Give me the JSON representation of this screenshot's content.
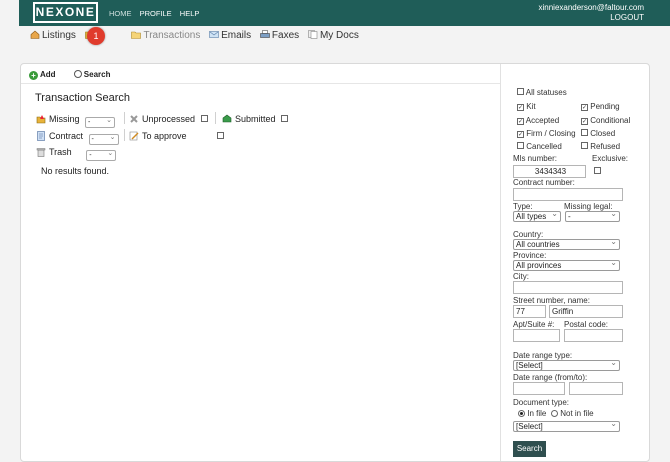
{
  "header": {
    "logo": "NEXONE",
    "nav": [
      "HOME",
      "PROFILE",
      "HELP"
    ],
    "user_email": "xinniexanderson@faltour.com",
    "logout": "LOGOUT",
    "bg_color": "#1f5d58"
  },
  "tabs": [
    {
      "label": "Listings",
      "icon": "house-icon"
    },
    {
      "label": "Transactions",
      "icon": "folder-icon"
    },
    {
      "label": "Emails",
      "icon": "envelope-icon"
    },
    {
      "label": "Faxes",
      "icon": "printer-icon"
    },
    {
      "label": "My Docs",
      "icon": "documents-icon"
    }
  ],
  "step_badge": "1",
  "toolbar": {
    "add": "Add",
    "search": "Search"
  },
  "main": {
    "title": "Transaction Search",
    "filters": {
      "missing": {
        "label": "Missing",
        "value": "-"
      },
      "contract": {
        "label": "Contract",
        "value": "-"
      },
      "trash": {
        "label": "Trash",
        "value": "-"
      },
      "unprocessed": {
        "label": "Unprocessed",
        "checked": false
      },
      "to_approve": {
        "label": "To approve",
        "checked": false
      },
      "submitted": {
        "label": "Submitted",
        "checked": false
      }
    },
    "no_results": "No results found."
  },
  "side": {
    "statuses": {
      "all": {
        "label": "All statuses",
        "checked": false
      },
      "kit": {
        "label": "Kit",
        "checked": true
      },
      "pending": {
        "label": "Pending",
        "checked": true
      },
      "accepted": {
        "label": "Accepted",
        "checked": true
      },
      "conditional": {
        "label": "Conditional",
        "checked": true
      },
      "firm_closing": {
        "label": "Firm / Closing",
        "checked": true
      },
      "closed": {
        "label": "Closed",
        "checked": false
      },
      "cancelled": {
        "label": "Cancelled",
        "checked": false
      },
      "refused": {
        "label": "Refused",
        "checked": false
      }
    },
    "mls_label": "Mls number:",
    "mls_value": "3434343",
    "exclusive_label": "Exclusive:",
    "contract_label": "Contract number:",
    "contract_value": "",
    "type_label": "Type:",
    "type_value": "All types",
    "missing_legal_label": "Missing legal:",
    "missing_legal_value": "-",
    "country_label": "Country:",
    "country_value": "All countries",
    "province_label": "Province:",
    "province_value": "All provinces",
    "city_label": "City:",
    "city_value": "",
    "street_label": "Street number, name:",
    "street_number": "77",
    "street_name": "Griffin",
    "apt_label": "Apt/Suite #:",
    "postal_label": "Postal code:",
    "date_type_label": "Date range type:",
    "date_type_value": "[Select]",
    "date_range_label": "Date range (from/to):",
    "doc_type_label": "Document type:",
    "in_file": "In file",
    "not_in_file": "Not in file",
    "doc_type_value": "[Select]",
    "search_button": "Search"
  }
}
